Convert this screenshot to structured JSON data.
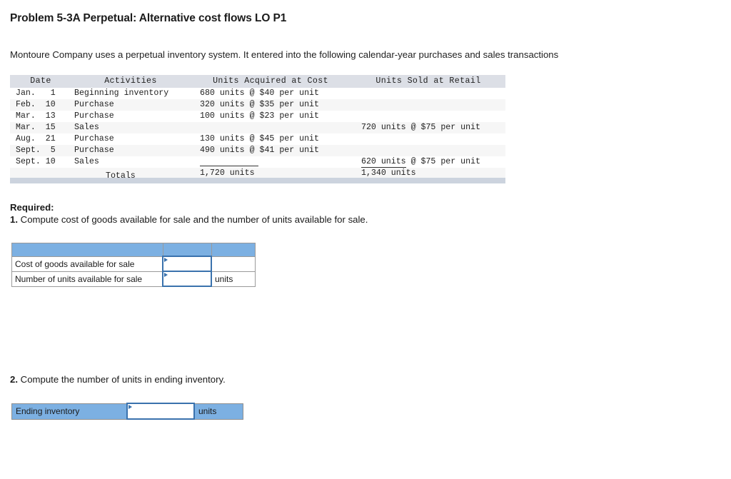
{
  "problem": {
    "title": "Problem 5-3A Perpetual: Alternative cost flows LO P1",
    "intro": "Montoure Company uses a perpetual inventory system. It entered into the following calendar-year purchases and sales transactions"
  },
  "transactions_table": {
    "headers": {
      "date": "Date",
      "activities": "Activities",
      "acquired": "Units Acquired at Cost",
      "sold": "Units Sold at Retail"
    },
    "rows": [
      {
        "date_month": "Jan.",
        "date_day": "1",
        "activity": "Beginning inventory",
        "acquired": "680 units @ $40 per unit",
        "sold": ""
      },
      {
        "date_month": "Feb.",
        "date_day": "10",
        "activity": "Purchase",
        "acquired": "320 units @ $35 per unit",
        "sold": ""
      },
      {
        "date_month": "Mar.",
        "date_day": "13",
        "activity": "Purchase",
        "acquired": "100 units @ $23 per unit",
        "sold": ""
      },
      {
        "date_month": "Mar.",
        "date_day": "15",
        "activity": "Sales",
        "acquired": "",
        "sold": "720 units @ $75 per unit"
      },
      {
        "date_month": "Aug.",
        "date_day": "21",
        "activity": "Purchase",
        "acquired": "130 units @ $45 per unit",
        "sold": ""
      },
      {
        "date_month": "Sept.",
        "date_day": "5",
        "activity": "Purchase",
        "acquired": "490 units @ $41 per unit",
        "sold": ""
      },
      {
        "date_month": "Sept.",
        "date_day": "10",
        "activity": "Sales",
        "acquired": "",
        "sold": "620 units @ $75 per unit"
      }
    ],
    "totals": {
      "label": "Totals",
      "acquired": "1,720 units",
      "sold": "1,340 units"
    }
  },
  "required": {
    "heading": "Required:",
    "item1_number": "1.",
    "item1_text": " Compute cost of goods available for sale and the number of units available for sale.",
    "item2_number": "2.",
    "item2_text": " Compute the number of units in ending inventory."
  },
  "answer_grid_1": {
    "rows": [
      {
        "label": "Cost of goods available for sale",
        "value": "",
        "unit": ""
      },
      {
        "label": "Number of units available for sale",
        "value": "",
        "unit": "units"
      }
    ]
  },
  "answer_grid_2": {
    "label": "Ending inventory",
    "value": "",
    "unit": "units"
  },
  "colors": {
    "header_blue": "#7cb0e2",
    "input_border": "#3a72ad",
    "table_header_gray": "#dcdfe6",
    "footer_bar": "#ccd3de"
  }
}
